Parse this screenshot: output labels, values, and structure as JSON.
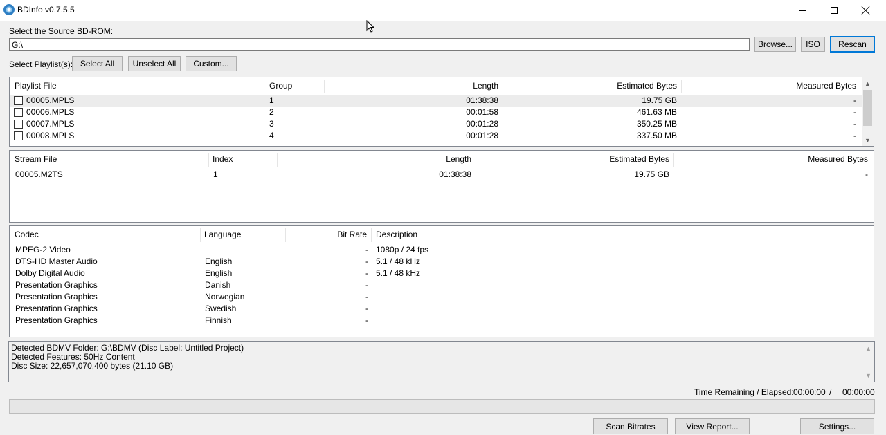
{
  "window": {
    "title": "BDInfo v0.7.5.5"
  },
  "source": {
    "label": "Select the Source BD-ROM:",
    "value": "G:\\",
    "browse": "Browse...",
    "iso": "ISO",
    "rescan": "Rescan"
  },
  "playlists_bar": {
    "label": "Select Playlist(s):",
    "select_all": "Select All",
    "unselect_all": "Unselect All",
    "custom": "Custom..."
  },
  "playlist_table": {
    "columns": [
      "Playlist File",
      "Group",
      "Length",
      "Estimated Bytes",
      "Measured Bytes"
    ],
    "rows": [
      {
        "file": "00005.MPLS",
        "group": "1",
        "length": "01:38:38",
        "estimated": "19.75 GB",
        "measured": "-"
      },
      {
        "file": "00006.MPLS",
        "group": "2",
        "length": "00:01:58",
        "estimated": "461.63 MB",
        "measured": "-"
      },
      {
        "file": "00007.MPLS",
        "group": "3",
        "length": "00:01:28",
        "estimated": "350.25 MB",
        "measured": "-"
      },
      {
        "file": "00008.MPLS",
        "group": "4",
        "length": "00:01:28",
        "estimated": "337.50 MB",
        "measured": "-"
      }
    ]
  },
  "stream_table": {
    "columns": [
      "Stream File",
      "Index",
      "Length",
      "Estimated Bytes",
      "Measured Bytes"
    ],
    "rows": [
      {
        "file": "00005.M2TS",
        "index": "1",
        "length": "01:38:38",
        "estimated": "19.75 GB",
        "measured": "-"
      }
    ]
  },
  "codec_table": {
    "columns": [
      "Codec",
      "Language",
      "Bit Rate",
      "Description"
    ],
    "rows": [
      {
        "codec": "MPEG-2 Video",
        "language": "",
        "bitrate": "-",
        "description": "1080p / 24 fps"
      },
      {
        "codec": "DTS-HD Master Audio",
        "language": "English",
        "bitrate": "-",
        "description": "5.1 / 48 kHz"
      },
      {
        "codec": "Dolby Digital Audio",
        "language": "English",
        "bitrate": "-",
        "description": "5.1 / 48 kHz"
      },
      {
        "codec": "Presentation Graphics",
        "language": "Danish",
        "bitrate": "-",
        "description": ""
      },
      {
        "codec": "Presentation Graphics",
        "language": "Norwegian",
        "bitrate": "-",
        "description": ""
      },
      {
        "codec": "Presentation Graphics",
        "language": "Swedish",
        "bitrate": "-",
        "description": ""
      },
      {
        "codec": "Presentation Graphics",
        "language": "Finnish",
        "bitrate": "-",
        "description": ""
      }
    ]
  },
  "report": {
    "lines": [
      "Detected BDMV Folder: G:\\BDMV (Disc Label: Untitled Project)",
      "Detected Features: 50Hz Content",
      "Disc Size: 22,657,070,400 bytes (21.10 GB)"
    ]
  },
  "status": {
    "label": "Time Remaining / Elapsed:",
    "remaining": "00:00:00",
    "separator": "/",
    "elapsed": "00:00:00"
  },
  "progress": {
    "value": 0
  },
  "footer": {
    "scan_bitrates": "Scan Bitrates",
    "view_report": "View Report...",
    "settings": "Settings..."
  },
  "colors": {
    "accent": "#0078d7",
    "window_bg": "#f0f0f0"
  }
}
